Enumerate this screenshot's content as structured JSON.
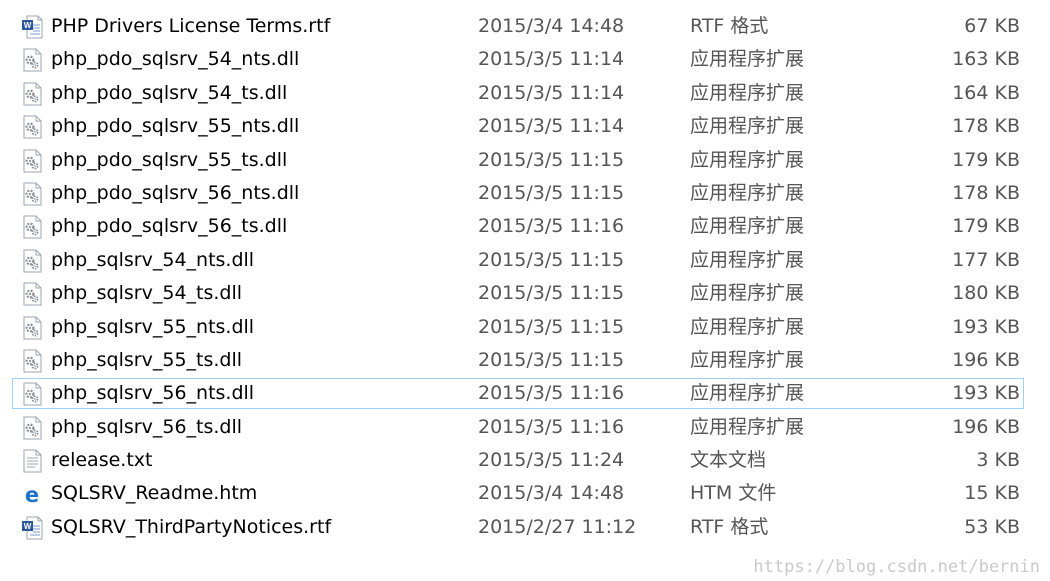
{
  "files": [
    {
      "name": "PHP Drivers License Terms.rtf",
      "date": "2015/3/4 14:48",
      "type": "RTF 格式",
      "size": "67 KB",
      "icon": "word-document-icon"
    },
    {
      "name": "php_pdo_sqlsrv_54_nts.dll",
      "date": "2015/3/5 11:14",
      "type": "应用程序扩展",
      "size": "163 KB",
      "icon": "dll-gear-icon"
    },
    {
      "name": "php_pdo_sqlsrv_54_ts.dll",
      "date": "2015/3/5 11:14",
      "type": "应用程序扩展",
      "size": "164 KB",
      "icon": "dll-gear-icon"
    },
    {
      "name": "php_pdo_sqlsrv_55_nts.dll",
      "date": "2015/3/5 11:14",
      "type": "应用程序扩展",
      "size": "178 KB",
      "icon": "dll-gear-icon"
    },
    {
      "name": "php_pdo_sqlsrv_55_ts.dll",
      "date": "2015/3/5 11:15",
      "type": "应用程序扩展",
      "size": "179 KB",
      "icon": "dll-gear-icon"
    },
    {
      "name": "php_pdo_sqlsrv_56_nts.dll",
      "date": "2015/3/5 11:15",
      "type": "应用程序扩展",
      "size": "178 KB",
      "icon": "dll-gear-icon"
    },
    {
      "name": "php_pdo_sqlsrv_56_ts.dll",
      "date": "2015/3/5 11:16",
      "type": "应用程序扩展",
      "size": "179 KB",
      "icon": "dll-gear-icon"
    },
    {
      "name": "php_sqlsrv_54_nts.dll",
      "date": "2015/3/5 11:15",
      "type": "应用程序扩展",
      "size": "177 KB",
      "icon": "dll-gear-icon"
    },
    {
      "name": "php_sqlsrv_54_ts.dll",
      "date": "2015/3/5 11:15",
      "type": "应用程序扩展",
      "size": "180 KB",
      "icon": "dll-gear-icon"
    },
    {
      "name": "php_sqlsrv_55_nts.dll",
      "date": "2015/3/5 11:15",
      "type": "应用程序扩展",
      "size": "193 KB",
      "icon": "dll-gear-icon"
    },
    {
      "name": "php_sqlsrv_55_ts.dll",
      "date": "2015/3/5 11:15",
      "type": "应用程序扩展",
      "size": "196 KB",
      "icon": "dll-gear-icon"
    },
    {
      "name": "php_sqlsrv_56_nts.dll",
      "date": "2015/3/5 11:16",
      "type": "应用程序扩展",
      "size": "193 KB",
      "icon": "dll-gear-icon",
      "selected": true
    },
    {
      "name": "php_sqlsrv_56_ts.dll",
      "date": "2015/3/5 11:16",
      "type": "应用程序扩展",
      "size": "196 KB",
      "icon": "dll-gear-icon"
    },
    {
      "name": "release.txt",
      "date": "2015/3/5 11:24",
      "type": "文本文档",
      "size": "3 KB",
      "icon": "text-document-icon"
    },
    {
      "name": "SQLSRV_Readme.htm",
      "date": "2015/3/4 14:48",
      "type": "HTM 文件",
      "size": "15 KB",
      "icon": "edge-browser-icon"
    },
    {
      "name": "SQLSRV_ThirdPartyNotices.rtf",
      "date": "2015/2/27 11:12",
      "type": "RTF 格式",
      "size": "53 KB",
      "icon": "word-document-icon"
    }
  ],
  "watermark": "https://blog.csdn.net/bernin",
  "colors": {
    "selection_border": "#99d1ff",
    "word_blue": "#2b579a",
    "edge_blue": "#1e73c9",
    "secondary_text": "#555555"
  }
}
